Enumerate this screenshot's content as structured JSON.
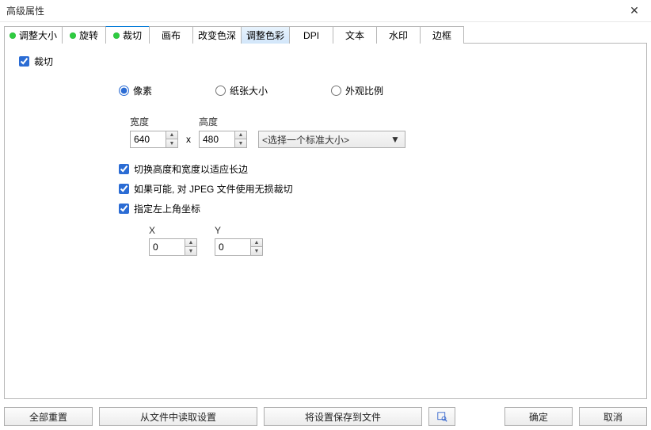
{
  "title": "高级属性",
  "tabs": [
    {
      "label": "调整大小",
      "dot": true
    },
    {
      "label": "旋转",
      "dot": true
    },
    {
      "label": "裁切",
      "dot": true
    },
    {
      "label": "画布",
      "dot": false
    },
    {
      "label": "改变色深",
      "dot": false
    },
    {
      "label": "调整色彩",
      "dot": false
    },
    {
      "label": "DPI",
      "dot": false
    },
    {
      "label": "文本",
      "dot": false
    },
    {
      "label": "水印",
      "dot": false
    },
    {
      "label": "边框",
      "dot": false
    }
  ],
  "crop": {
    "enable_label": "裁切",
    "radio_pixel": "像素",
    "radio_paper": "纸张大小",
    "radio_aspect": "外观比例",
    "width_label": "宽度",
    "height_label": "高度",
    "width_value": "640",
    "height_value": "480",
    "preset_value": "<选择一个标准大小>",
    "cb_swap": "切换高度和宽度以适应长边",
    "cb_lossless": "如果可能, 对 JPEG 文件使用无损裁切",
    "cb_topleft": "指定左上角坐标",
    "x_label": "X",
    "y_label": "Y",
    "x_value": "0",
    "y_value": "0"
  },
  "footer": {
    "reset_all": "全部重置",
    "load": "从文件中读取设置",
    "save": "将设置保存到文件",
    "ok": "确定",
    "cancel": "取消"
  }
}
